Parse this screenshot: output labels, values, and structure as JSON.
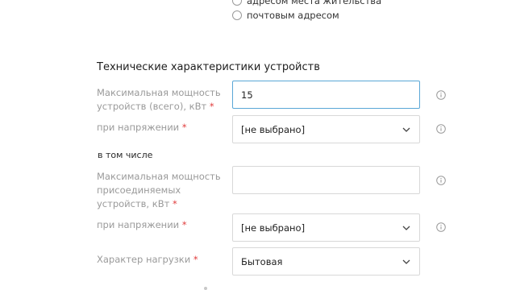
{
  "delivery_options": {
    "partial_option_label": "адресом места жительства",
    "postal_option_label": "почтовым адресом"
  },
  "section": {
    "title": "Технические характеристики устройств"
  },
  "fields": {
    "max_power_total": {
      "label_line1": "Максимальная мощность",
      "label_line2": "устройств (всего), кВт",
      "required": "*",
      "value": "15"
    },
    "voltage_total": {
      "label": "при напряжении",
      "required": "*",
      "value": "[не выбрано]"
    },
    "including_label": "в том числе",
    "max_power_connected": {
      "label_line1": "Максимальная мощность",
      "label_line2": "присоединяемых",
      "label_line3": "устройств, кВт",
      "required": "*",
      "value": ""
    },
    "voltage_connected": {
      "label": "при напряжении",
      "required": "*",
      "value": "[не выбрано]"
    },
    "load_type": {
      "label": "Характер нагрузки",
      "required": "*",
      "value": "Бытовая"
    }
  },
  "icons": {
    "info": "info-circle-icon",
    "chevron": "chevron-down-icon"
  },
  "colors": {
    "focus_border": "#5aa7d6",
    "required": "#e03b3b",
    "label": "#9a9a9a"
  }
}
